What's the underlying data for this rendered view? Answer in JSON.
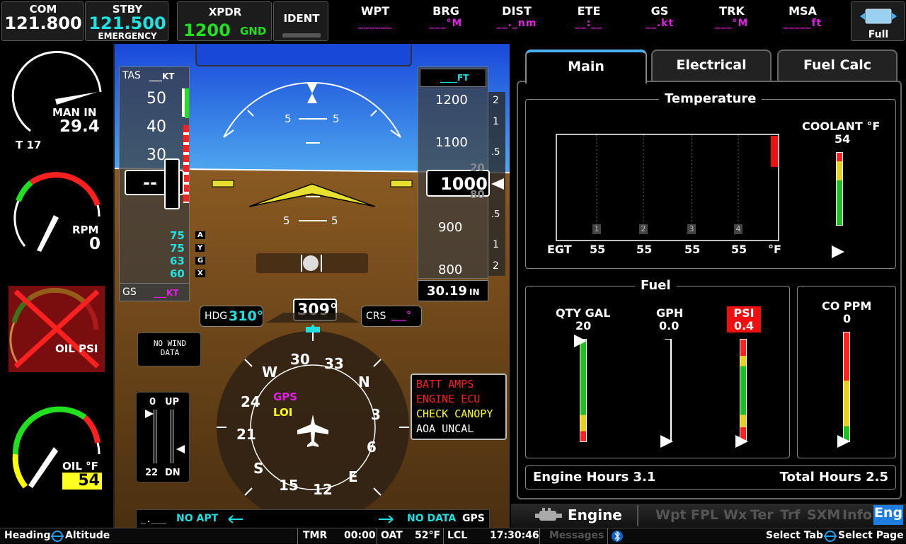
{
  "com": {
    "label": "COM",
    "active": "121.800",
    "stby_label": "STBY",
    "stby": "121.500",
    "stby_name": "EMERGENCY"
  },
  "xpdr": {
    "label": "XPDR",
    "code": "1200",
    "mode": "GND",
    "ident_label": "IDENT"
  },
  "nav_fields": [
    {
      "label": "WPT",
      "value": "______"
    },
    {
      "label": "BRG",
      "value": "___°M"
    },
    {
      "label": "DIST",
      "value": "__._nm"
    },
    {
      "label": "ETE",
      "value": "__:__"
    },
    {
      "label": "GS",
      "value": "__.kt"
    },
    {
      "label": "TRK",
      "value": "___°M"
    },
    {
      "label": "MSA",
      "value": "_____ft"
    }
  ],
  "full_button": {
    "label": "Full"
  },
  "engine_gauges": {
    "man_in": {
      "label": "MAN IN",
      "value": "29.4",
      "t_label": "T 17",
      "fraction": 0.85
    },
    "rpm": {
      "label": "RPM",
      "value": "0",
      "fraction": 0.0
    },
    "oil_psi": {
      "label": "OIL PSI",
      "failed": true
    },
    "oil_f": {
      "label": "OIL °F",
      "value": "54",
      "fraction": 0.05
    }
  },
  "pfd": {
    "tas_label": "TAS",
    "tas_value": "___KT",
    "speed_ticks": [
      "50",
      "40",
      "30"
    ],
    "speed_current": "--",
    "vspeeds": [
      {
        "value": "75",
        "tag": "A"
      },
      {
        "value": "75",
        "tag": "Y"
      },
      {
        "value": "63",
        "tag": "G"
      },
      {
        "value": "60",
        "tag": "X"
      }
    ],
    "gs_label": "GS",
    "gs_value": "___KT",
    "alt_selected": "____FT",
    "alt_ticks": [
      "1200",
      "1100",
      "900",
      "800"
    ],
    "alt_current": "1000",
    "alt_roll_top": "20",
    "alt_roll_bottom": "80",
    "vsi_ticks": [
      "2",
      "1",
      ".5",
      ".5",
      "1",
      "2"
    ],
    "baro": "30.19",
    "baro_unit": "IN",
    "pitch_labels": [
      "5",
      "5",
      "5",
      "5"
    ],
    "hdg_label": "HDG",
    "hdg_value": "310°",
    "heading_current": "309°",
    "crs_label": "CRS",
    "crs_value": "___°",
    "wind": "NO WIND\nDATA",
    "compass_labels": [
      "30",
      "33",
      "N",
      "3",
      "6",
      "E",
      "12",
      "15",
      "S",
      "21",
      "24",
      "W"
    ],
    "nav_source": "GPS",
    "nav_mode": "LOI",
    "flaps": {
      "up_label": "UP",
      "dn_label": "DN",
      "top_value": "0",
      "bottom_value": "22"
    },
    "alerts": [
      {
        "text": "BATT AMPS",
        "color": "#ff2020"
      },
      {
        "text": "ENGINE ECU",
        "color": "#ff2020"
      },
      {
        "text": "CHECK CANOPY",
        "color": "#ffff00"
      },
      {
        "text": "AOA UNCAL",
        "color": "#ffffff"
      }
    ],
    "bottom_left": "_.___",
    "bottom_apt": "NO APT",
    "bottom_data": "NO DATA",
    "bottom_gps": "GPS"
  },
  "mfd": {
    "tabs": [
      {
        "label": "Main"
      },
      {
        "label": "Electrical"
      },
      {
        "label": "Fuel Calc"
      }
    ],
    "temperature_title": "Temperature",
    "egt_label": "EGT",
    "egt_values": [
      "55",
      "55",
      "55",
      "55"
    ],
    "egt_unit": "°F",
    "cyl_numbers": [
      "1",
      "2",
      "3",
      "4"
    ],
    "coolant": {
      "label": "COOLANT °F",
      "value": "54"
    },
    "fuel_title": "Fuel",
    "qty": {
      "label": "QTY GAL",
      "value": "20",
      "fraction": 1.0
    },
    "gph": {
      "label": "GPH",
      "value": "0.0",
      "fraction": 0.0
    },
    "psi": {
      "label": "PSI",
      "value": "0.4",
      "fraction": 0.0
    },
    "co": {
      "label": "CO PPM",
      "value": "0",
      "fraction": 0.0
    },
    "engine_hours": "Engine Hours 3.1",
    "total_hours": "Total Hours 2.5",
    "page_name": "Engine",
    "page_tabs": [
      "Wpt",
      "FPL",
      "Wx",
      "Ter",
      "Trf",
      "SXM",
      "Info",
      "Eng"
    ]
  },
  "bottom": {
    "heading": "Heading",
    "altitude": "Altitude",
    "tmr_label": "TMR",
    "tmr_value": "00:00",
    "oat_label": "OAT",
    "oat_value": "52°F",
    "lcl_label": "LCL",
    "lcl_value": "17:30:46",
    "messages": "Messages",
    "select_tab": "Select Tab",
    "select_page": "Select Page"
  },
  "colors": {
    "cyan": "#20e0e0",
    "magenta": "#e020e0",
    "green": "#20e020",
    "sky": "#2070e0",
    "ground": "#6b4516"
  }
}
